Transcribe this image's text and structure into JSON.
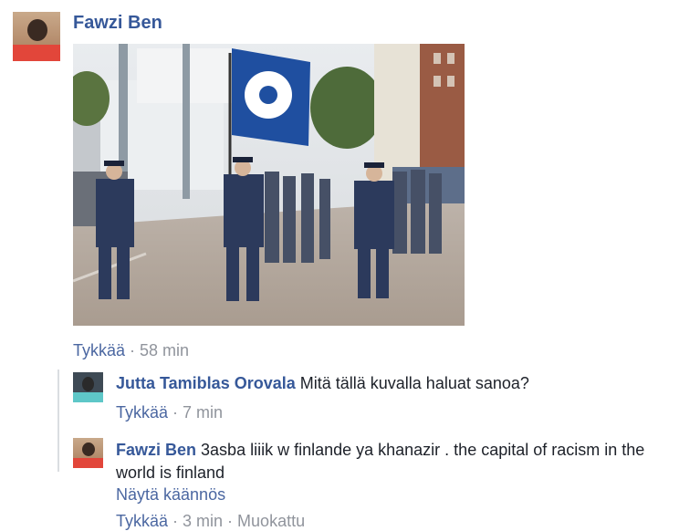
{
  "post": {
    "author": "Fawzi Ben",
    "actions": {
      "like": "Tykkää",
      "sep": " · ",
      "time": "58 min"
    }
  },
  "replies": [
    {
      "author": "Jutta Tamiblas Orovala",
      "text": "Mitä tällä kuvalla haluat sanoa?",
      "actions": {
        "like": "Tykkää",
        "sep": " · ",
        "time": "7 min"
      }
    },
    {
      "author": "Fawzi Ben",
      "text": "3asba liiik w finlande ya khanazir . the capital of racism in the world is finland",
      "see_translation": "Näytä käännös",
      "actions": {
        "like": "Tykkää",
        "sep": " · ",
        "time": "3 min",
        "sep2": " · ",
        "edited": "Muokattu"
      }
    }
  ],
  "colors": {
    "link": "#365899",
    "action": "#4b67a1",
    "meta": "#90949c",
    "text": "#1d2129"
  }
}
